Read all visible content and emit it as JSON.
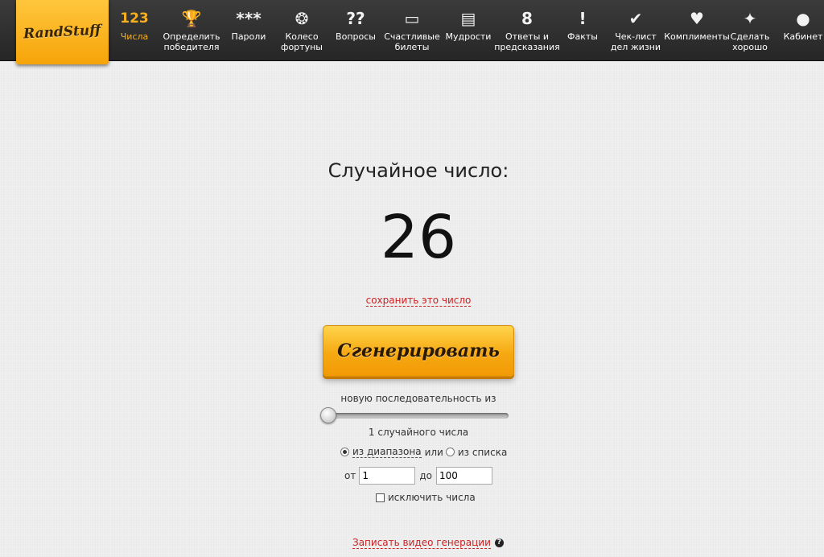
{
  "logo": {
    "text": "RandStuff"
  },
  "nav": {
    "items": [
      {
        "icon": "numbers-icon",
        "glyph": "123",
        "label": "Числа",
        "active": true
      },
      {
        "icon": "trophy-icon",
        "glyph": "🏆",
        "label": "Определить\nпобедителя"
      },
      {
        "icon": "password-icon",
        "glyph": "***",
        "label": "Пароли"
      },
      {
        "icon": "wheel-icon",
        "glyph": "❂",
        "label": "Колесо\nфортуны"
      },
      {
        "icon": "questions-icon",
        "glyph": "??",
        "label": "Вопросы"
      },
      {
        "icon": "tickets-icon",
        "glyph": "▭",
        "label": "Счастливые\nбилеты"
      },
      {
        "icon": "scroll-icon",
        "glyph": "▤",
        "label": "Мудрости"
      },
      {
        "icon": "ball-icon",
        "glyph": "8",
        "label": "Ответы и\nпредсказания"
      },
      {
        "icon": "diamond-icon",
        "glyph": "!",
        "label": "Факты"
      },
      {
        "icon": "badge-check-icon",
        "glyph": "✔",
        "label": "Чек-лист\nдел жизни"
      },
      {
        "icon": "heart-icon",
        "glyph": "♥",
        "label": "Комплименты"
      },
      {
        "icon": "sparkle-icon",
        "glyph": "✦",
        "label": "Сделать\nхорошо"
      },
      {
        "icon": "user-icon",
        "glyph": "●",
        "label": "Кабинет"
      }
    ]
  },
  "main": {
    "title": "Случайное число:",
    "number": "26",
    "save_link": "сохранить это число",
    "generate_button": "Сгенерировать",
    "sequence_label": "новую последовательность из",
    "sequence_count": 1,
    "sequence_max": 10,
    "count_label": "1 случайного числа",
    "mode": {
      "range_label": "из диапазона",
      "or_label": "или",
      "list_label": "из списка",
      "selected": "range"
    },
    "range": {
      "from_label": "от",
      "from_value": "1",
      "to_label": "до",
      "to_value": "100"
    },
    "exclude_label": "исключить числа",
    "exclude_checked": false,
    "video_link": "Записать видео генерации",
    "help_glyph": "?"
  },
  "colors": {
    "accent": "#f6a912",
    "link": "#cc2222",
    "topbar": "#2e2e2e"
  }
}
